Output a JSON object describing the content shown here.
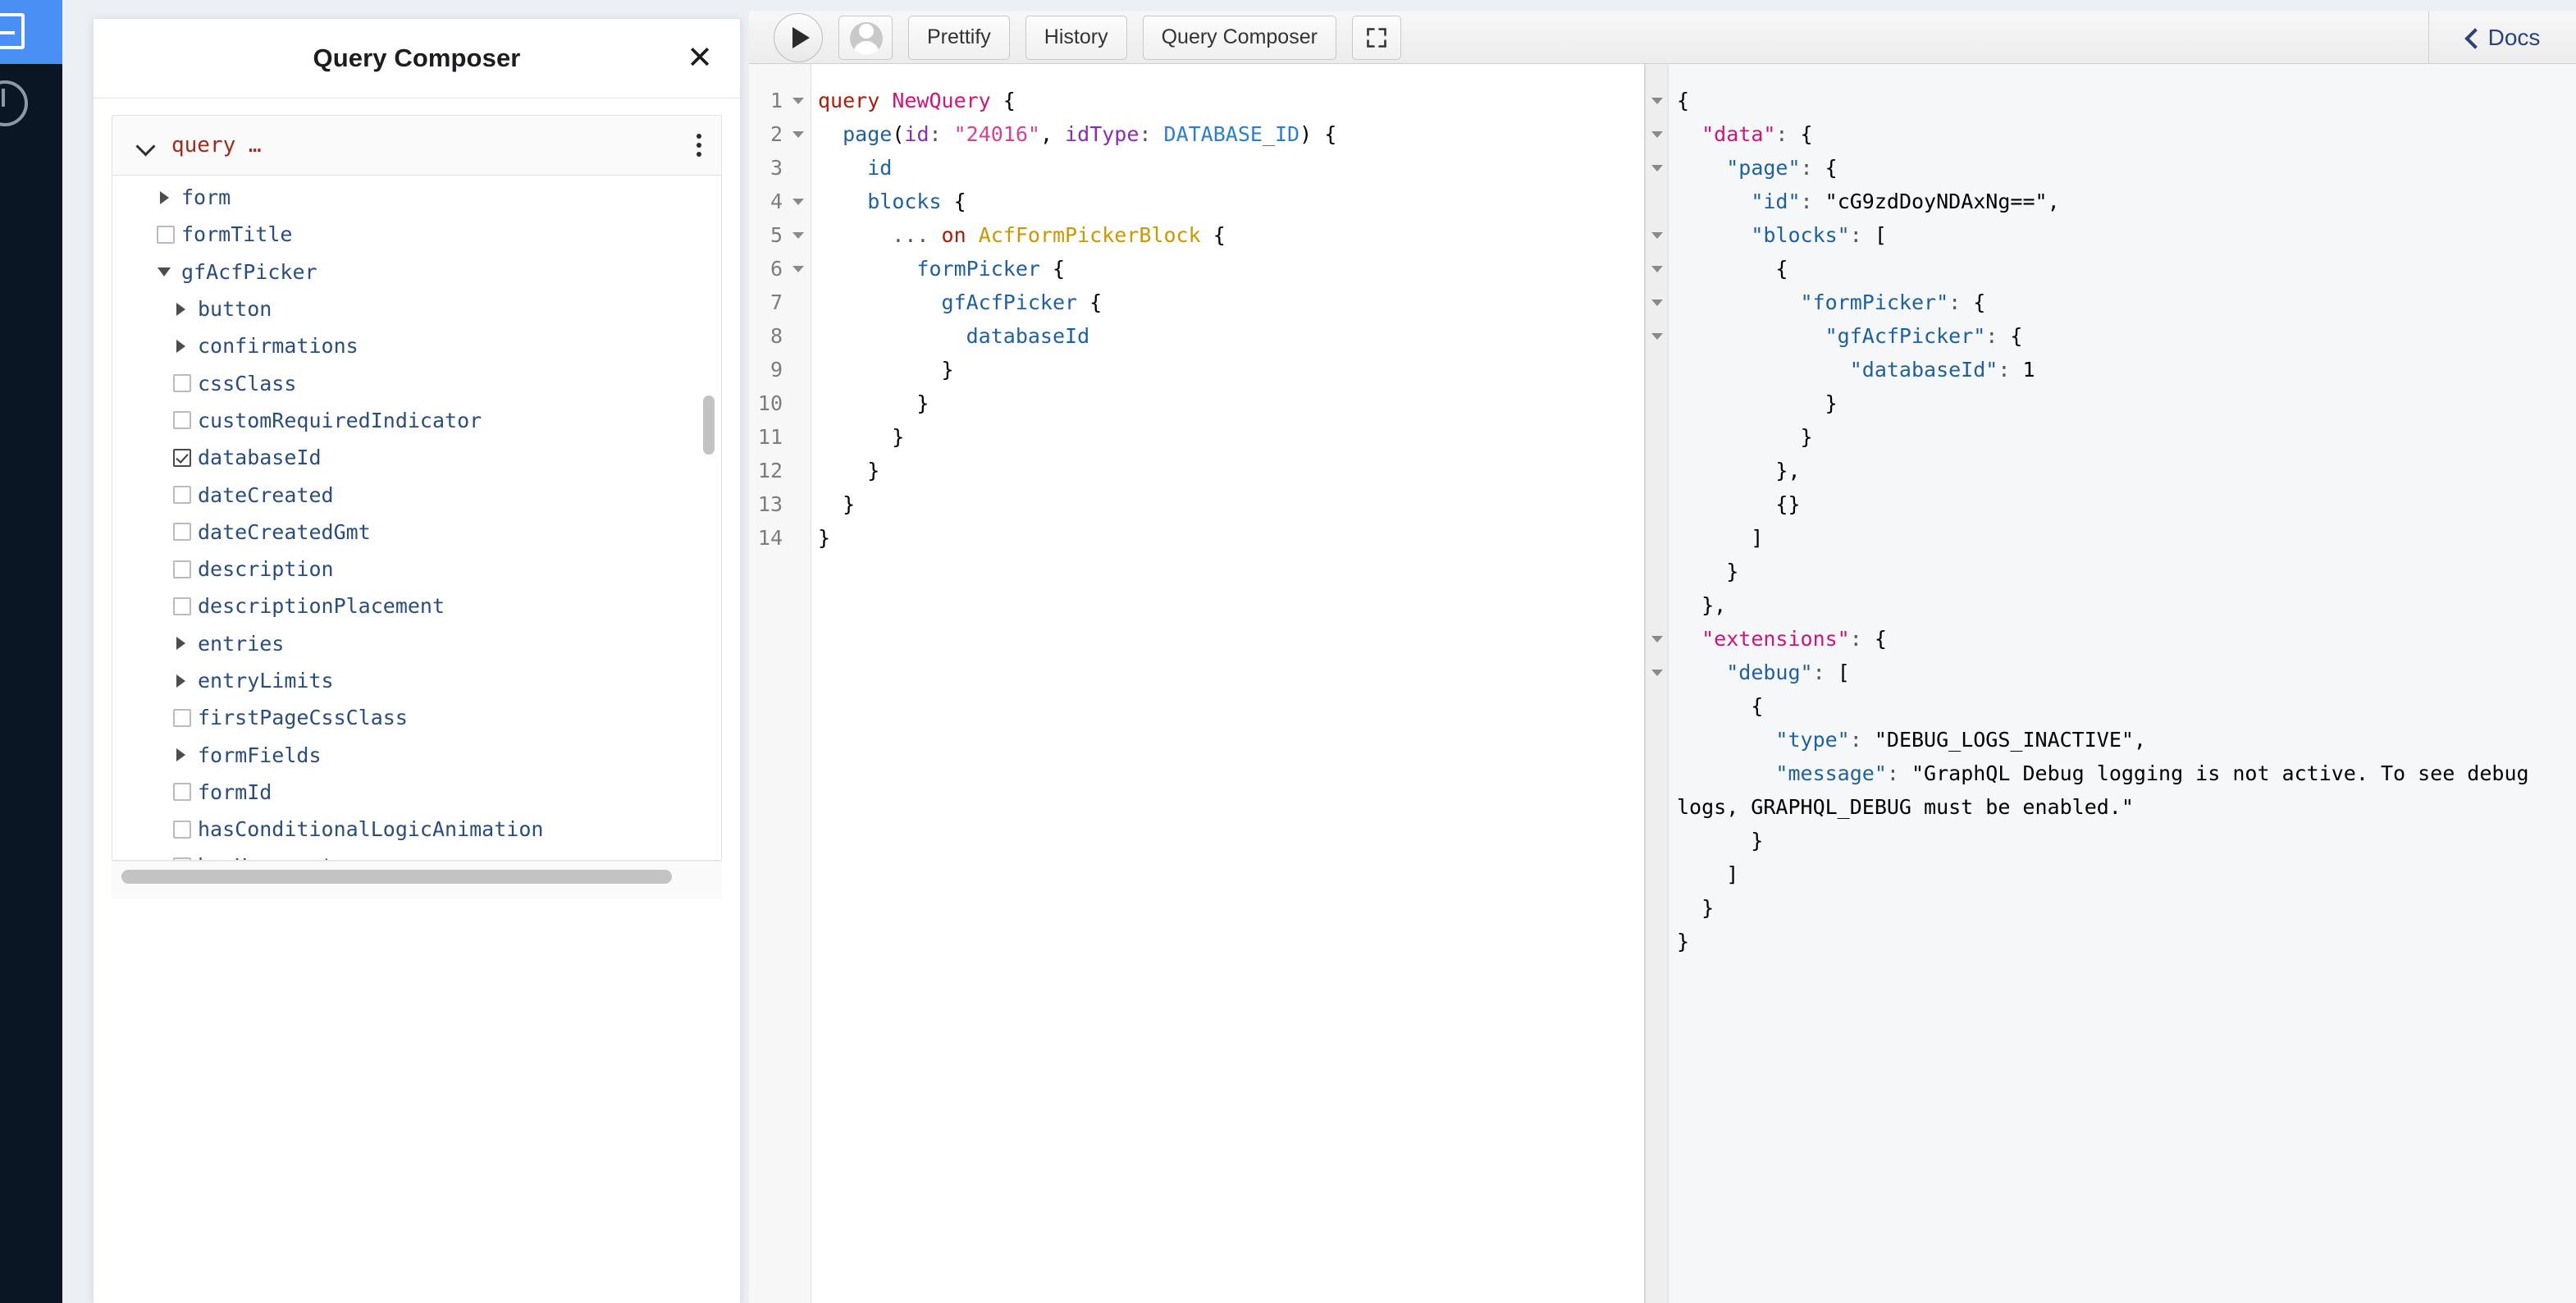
{
  "app": {
    "title": "Query Composer",
    "close_label": "✕"
  },
  "rail": {
    "logo_icon": "wordpress-admin-logo",
    "menu_icon": "dashboard-circle-icon"
  },
  "composer": {
    "title": "Query Composer",
    "root": {
      "label": "query …",
      "chevron_icon": "chevron-down-icon",
      "menu_icon": "kebab-menu-icon"
    },
    "fields": [
      {
        "label": "form",
        "indent": 2,
        "type": "expandable",
        "state": "collapsed"
      },
      {
        "label": "formTitle",
        "indent": 2,
        "type": "checkbox",
        "checked": false
      },
      {
        "label": "gfAcfPicker",
        "indent": 2,
        "type": "expandable",
        "state": "expanded"
      },
      {
        "label": "button",
        "indent": 3,
        "type": "expandable",
        "state": "collapsed"
      },
      {
        "label": "confirmations",
        "indent": 3,
        "type": "expandable",
        "state": "collapsed"
      },
      {
        "label": "cssClass",
        "indent": 3,
        "type": "checkbox",
        "checked": false
      },
      {
        "label": "customRequiredIndicator",
        "indent": 3,
        "type": "checkbox",
        "checked": false
      },
      {
        "label": "databaseId",
        "indent": 3,
        "type": "checkbox",
        "checked": true
      },
      {
        "label": "dateCreated",
        "indent": 3,
        "type": "checkbox",
        "checked": false
      },
      {
        "label": "dateCreatedGmt",
        "indent": 3,
        "type": "checkbox",
        "checked": false
      },
      {
        "label": "description",
        "indent": 3,
        "type": "checkbox",
        "checked": false
      },
      {
        "label": "descriptionPlacement",
        "indent": 3,
        "type": "checkbox",
        "checked": false
      },
      {
        "label": "entries",
        "indent": 3,
        "type": "expandable",
        "state": "collapsed"
      },
      {
        "label": "entryLimits",
        "indent": 3,
        "type": "expandable",
        "state": "collapsed"
      },
      {
        "label": "firstPageCssClass",
        "indent": 3,
        "type": "checkbox",
        "checked": false
      },
      {
        "label": "formFields",
        "indent": 3,
        "type": "expandable",
        "state": "collapsed"
      },
      {
        "label": "formId",
        "indent": 3,
        "type": "checkbox",
        "checked": false
      },
      {
        "label": "hasConditionalLogicAnimation",
        "indent": 3,
        "type": "checkbox",
        "checked": false
      },
      {
        "label": "hasHoneypot",
        "indent": 3,
        "type": "checkbox",
        "checked": false
      }
    ]
  },
  "toolbar": {
    "execute_icon": "play-icon",
    "account_icon": "user-avatar-icon",
    "prettify_label": "Prettify",
    "history_label": "History",
    "query_composer_label": "Query Composer",
    "fullscreen_icon": "expand-icon",
    "docs_label": "Docs",
    "docs_chevron_icon": "chevron-left-icon"
  },
  "editor": {
    "line_numbers": [
      1,
      2,
      3,
      4,
      5,
      6,
      7,
      8,
      9,
      10,
      11,
      12,
      13,
      14
    ],
    "folded_lines": [
      1,
      2,
      4,
      5,
      6
    ],
    "lines": [
      "query NewQuery {",
      "  page(id: \"24016\", idType: DATABASE_ID) {",
      "    id",
      "    blocks {",
      "      ... on AcfFormPickerBlock {",
      "        formPicker {",
      "          gfAcfPicker {",
      "            databaseId",
      "          }",
      "        }",
      "      }",
      "    }",
      "  }",
      "}"
    ],
    "query_name": "NewQuery",
    "page_id": "24016",
    "id_type": "DATABASE_ID",
    "fragment_type": "AcfFormPickerBlock"
  },
  "response": {
    "raw": "{\n  \"data\": {\n    \"page\": {\n      \"id\": \"cG9zdDoyNDAxNg==\",\n      \"blocks\": [\n        {\n          \"formPicker\": {\n            \"gfAcfPicker\": {\n              \"databaseId\": 1\n            }\n          }\n        },\n        {}\n      ]\n    }\n  },\n  \"extensions\": {\n    \"debug\": [\n      {\n        \"type\": \"DEBUG_LOGS_INACTIVE\",\n        \"message\": \"GraphQL Debug logging is not active. To see debug logs, GRAPHQL_DEBUG must be enabled.\"\n      }\n    ]\n  }\n}",
    "page_id_value": "cG9zdDoyNDAxNg==",
    "database_id_value": "1",
    "debug_type": "DEBUG_LOGS_INACTIVE",
    "debug_message": "GraphQL Debug logging is not active. To see debug logs, GRAPHQL_DEBUG must be enabled."
  },
  "colors": {
    "rail_accent": "#4a90f4",
    "rail_bg": "#0b1624",
    "keyword": "#b11a04",
    "string": "#d64292",
    "field": "#1f61a0",
    "type": "#ca9800",
    "number": "#2882f9",
    "docs_link": "#2b4377"
  }
}
